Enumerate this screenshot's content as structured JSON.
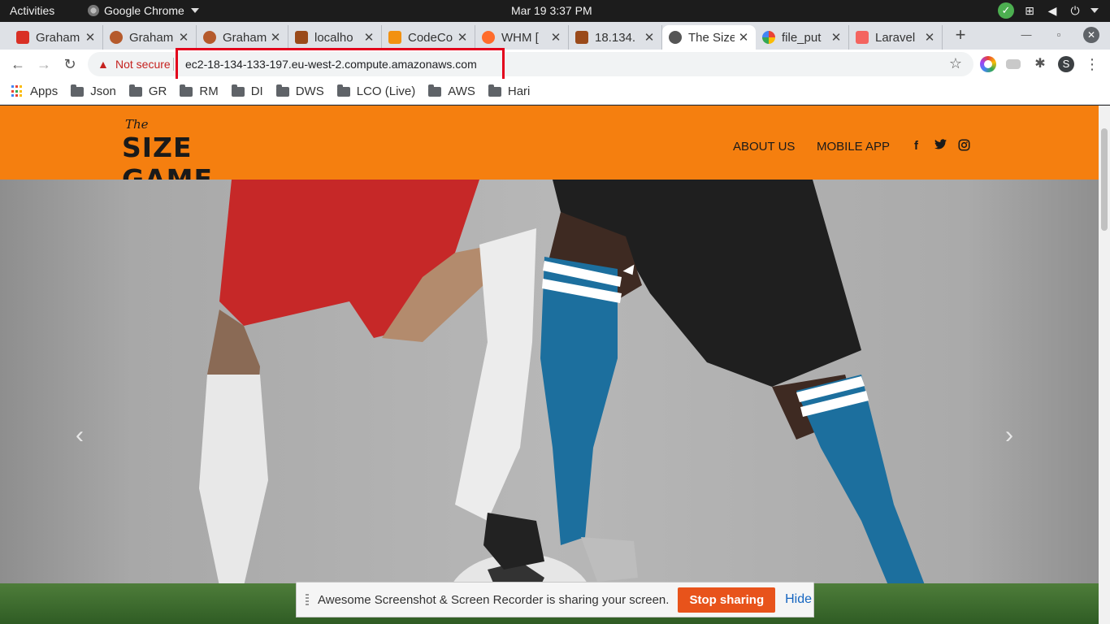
{
  "system": {
    "activities": "Activities",
    "app_name": "Google Chrome",
    "clock": "Mar 19   3:37 PM"
  },
  "tabs": [
    {
      "title": "Graham",
      "favicon_color": "#d93025"
    },
    {
      "title": "Graham",
      "favicon_color": "#b55a2c"
    },
    {
      "title": "Graham",
      "favicon_color": "#b55a2c"
    },
    {
      "title": "localho",
      "favicon_color": "#9a4a1a"
    },
    {
      "title": "CodeCo",
      "favicon_color": "#f29111"
    },
    {
      "title": "WHM [",
      "favicon_color": "#ff6c2c"
    },
    {
      "title": "18.134.",
      "favicon_color": "#9a4a1a"
    },
    {
      "title": "The Size",
      "favicon_color": "#555555"
    },
    {
      "title": "file_put",
      "favicon_color": "#4285f4"
    },
    {
      "title": "Laravel",
      "favicon_color": "#f4645f"
    }
  ],
  "toolbar": {
    "not_secure": "Not secure",
    "url": "ec2-18-134-133-197.eu-west-2.compute.amazonaws.com",
    "avatar_letter": "S"
  },
  "bookmarks": [
    {
      "label": "Apps",
      "kind": "apps"
    },
    {
      "label": "Json",
      "kind": "folder"
    },
    {
      "label": "GR",
      "kind": "folder"
    },
    {
      "label": "RM",
      "kind": "folder"
    },
    {
      "label": "DI",
      "kind": "folder"
    },
    {
      "label": "DWS",
      "kind": "folder"
    },
    {
      "label": "LCO (Live)",
      "kind": "folder"
    },
    {
      "label": "AWS",
      "kind": "folder"
    },
    {
      "label": "Hari",
      "kind": "folder"
    }
  ],
  "site": {
    "logo_the": "The",
    "logo_main": "SIZE GAME",
    "nav": [
      "ABOUT US",
      "MOBILE APP"
    ],
    "brand_color": "#f57f0f"
  },
  "carousel": {
    "prev": "‹",
    "next": "›"
  },
  "sharebar": {
    "message": "Awesome Screenshot & Screen Recorder is sharing your screen.",
    "stop": "Stop sharing",
    "hide": "Hide"
  }
}
